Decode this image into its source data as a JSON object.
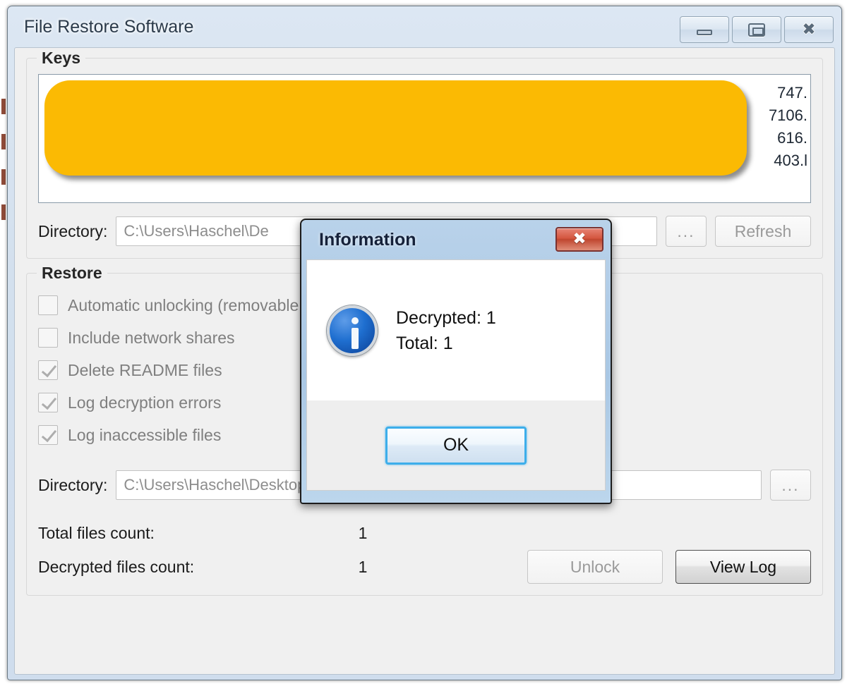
{
  "window": {
    "title": "File Restore Software",
    "buttons": {
      "minimize": "minimize-icon",
      "restore": "restore-icon",
      "close": "close-icon"
    }
  },
  "keys_group": {
    "legend": "Keys",
    "list_lines": "747.\n7106.\n616.\n403.l",
    "directory": {
      "label": "Directory:",
      "value": "C:\\Users\\Haschel\\De",
      "browse_label": "...",
      "refresh_label": "Refresh"
    }
  },
  "restore_group": {
    "legend": "Restore",
    "checkboxes": [
      {
        "label": "Automatic unlocking (removable drives & network shares)",
        "checked": false
      },
      {
        "label": "Include network shares",
        "checked": false
      },
      {
        "label": "Delete README files",
        "checked": true
      },
      {
        "label": "Log decryption errors",
        "checked": true
      },
      {
        "label": "Log inaccessible files",
        "checked": true
      }
    ],
    "directory": {
      "label": "Directory:",
      "value": "C:\\Users\\Haschel\\Desktop",
      "browse_label": "..."
    },
    "counts": [
      {
        "label": "Total files count:",
        "value": "1"
      },
      {
        "label": "Decrypted files count:",
        "value": "1"
      }
    ],
    "unlock_label": "Unlock",
    "view_log_label": "View Log"
  },
  "dialog": {
    "title": "Information",
    "close_glyph": "✕",
    "message": "Decrypted: 1\nTotal: 1",
    "ok_label": "OK",
    "icon": "information-icon"
  },
  "colors": {
    "redaction": "#fbba03",
    "dialog_close": "#d4563f",
    "focus_ring": "#3daeea",
    "frame": "#d3e0ee"
  }
}
